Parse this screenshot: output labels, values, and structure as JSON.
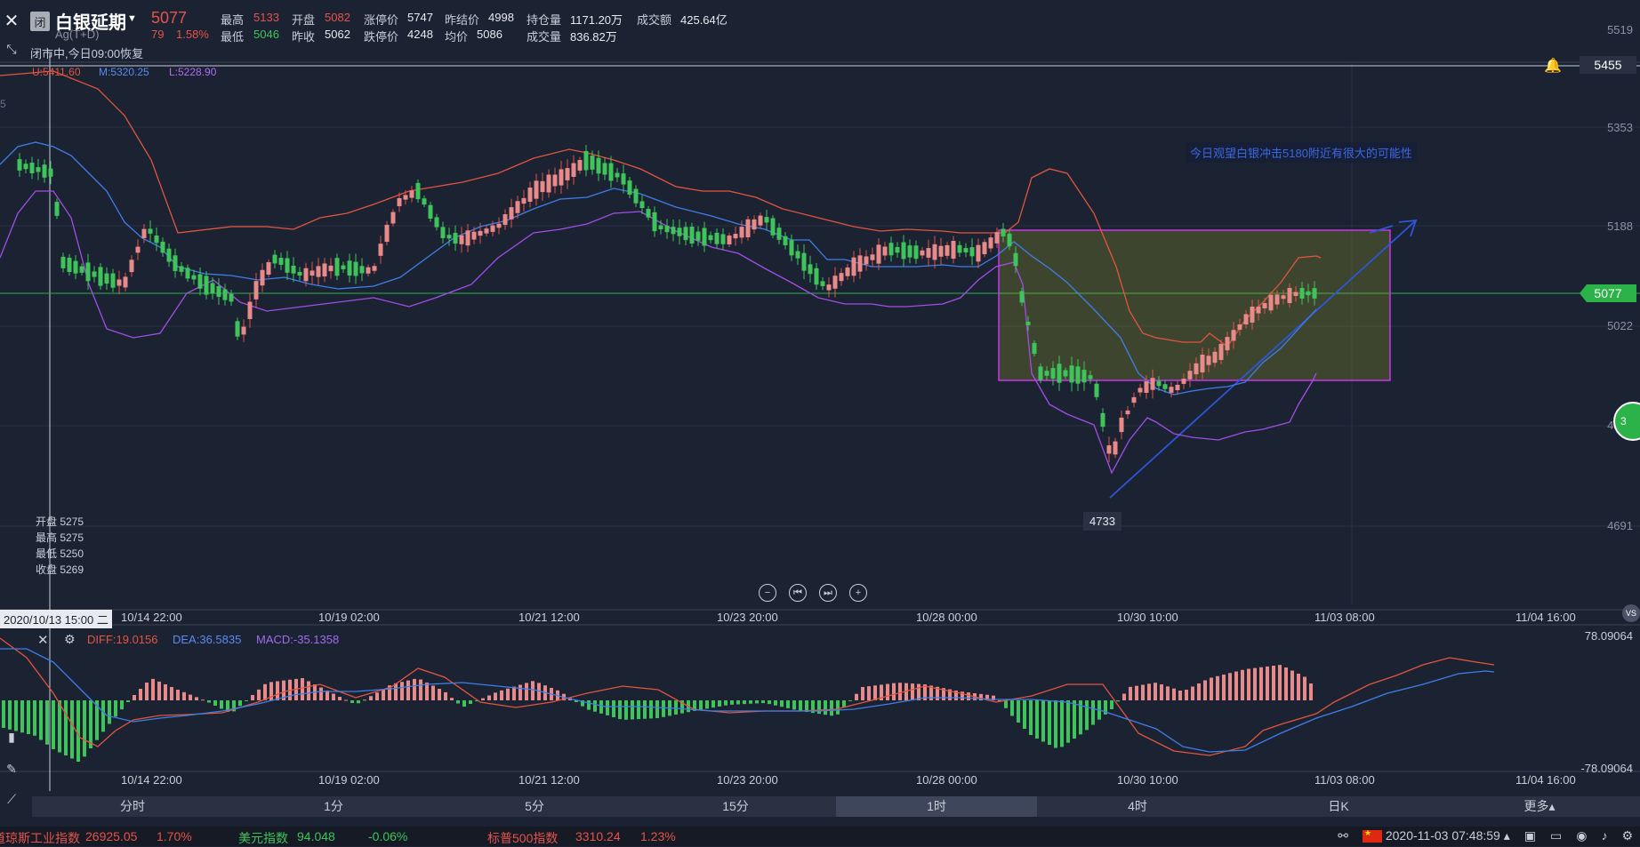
{
  "header": {
    "closed_badge": "闭",
    "name": "白银延期",
    "code": "Ag(T+D)",
    "last": "5077",
    "change": "79",
    "change_pct": "1.58%",
    "stats": {
      "high_label": "最高",
      "high": "5133",
      "low_label": "最低",
      "low": "5046",
      "open_label": "开盘",
      "open": "5082",
      "prev_close_label": "昨收",
      "prev_close": "5062",
      "limit_up_label": "涨停价",
      "limit_up": "5747",
      "limit_down_label": "跌停价",
      "limit_down": "4248",
      "prev_settle_label": "昨结价",
      "prev_settle": "4998",
      "avg_label": "均价",
      "avg": "5086",
      "oi_label": "持仓量",
      "oi": "1171.20万",
      "volume_label": "成交量",
      "volume": "836.82万",
      "turnover_label": "成交额",
      "turnover": "425.64亿"
    },
    "status": "闭市中,今日09:00恢复"
  },
  "boll": {
    "upper": "U:5411.60",
    "mid": "M:5320.25",
    "lower": "L:5228.90"
  },
  "price_axis": [
    "5519",
    "5353",
    "5188",
    "5022",
    "4857",
    "4691"
  ],
  "axis_partial_left": "5",
  "price_tags": {
    "line_price": "5455",
    "current_price": "5077"
  },
  "low_marker": "4733",
  "annotation": "今日观望白银冲击5180附近有很大的可能性",
  "ohlc_box": {
    "open": "开盘 5275",
    "high": "最高 5275",
    "low": "最低 5250",
    "close": "收盘 5269"
  },
  "x_labels": [
    "10/14 22:00",
    "10/19 02:00",
    "10/21 12:00",
    "10/23 20:00",
    "10/28 00:00",
    "10/30 10:00",
    "11/03 08:00",
    "11/04 16:00"
  ],
  "cross_date": "2020/10/13 15:00 二",
  "macd": {
    "diff": "DIFF:19.0156",
    "dea": "DEA:36.5835",
    "macd": "MACD:-35.1358",
    "axis_top": "78.09064",
    "axis_bottom": "-78.09064"
  },
  "timeframes": [
    "分时",
    "1分",
    "5分",
    "15分",
    "1时",
    "4时",
    "日K",
    "更多▴"
  ],
  "active_timeframe": "1时",
  "ticker": {
    "dji_name": "道琼斯工业指数",
    "dji_val": "26925.05",
    "dji_pct": "1.70%",
    "usd_name": "美元指数",
    "usd_val": "94.048",
    "usd_pct": "-0.06%",
    "spx_name": "标普500指数",
    "spx_val": "3310.24",
    "spx_pct": "1.23%",
    "datetime": "2020-11-03 07:48:59"
  },
  "badge_vs": "VS",
  "float_btn": "3",
  "colors": {
    "up": "#e5534b",
    "down": "#3ec45a",
    "bg": "#1b2232",
    "upper_band": "#e2553f",
    "mid_band": "#3f7fe8",
    "lower_band": "#a24ee6",
    "box_stroke": "#c637e6"
  }
}
